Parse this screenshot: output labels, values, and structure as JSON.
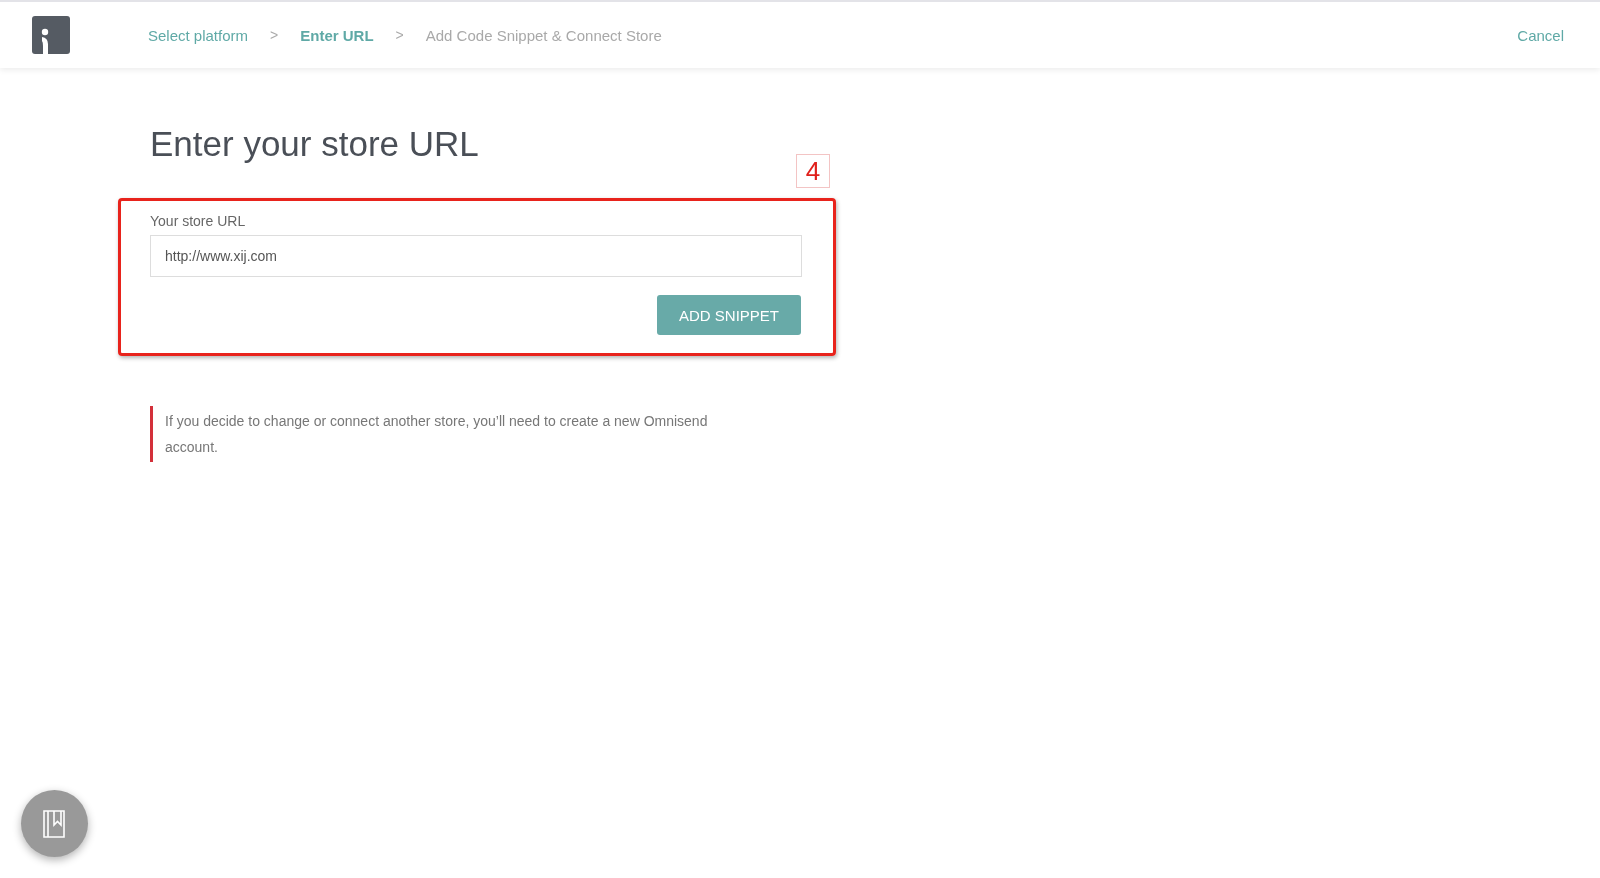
{
  "header": {
    "steps": [
      {
        "label": "Select platform",
        "selected": false,
        "disabled": false
      },
      {
        "label": "Enter URL",
        "selected": true,
        "disabled": false
      },
      {
        "label": "Add Code Snippet & Connect Store",
        "selected": false,
        "disabled": true
      }
    ],
    "separators": [
      ">",
      ">"
    ],
    "cancel": "Cancel"
  },
  "title": "Enter your store URL",
  "annotation": {
    "number": "4"
  },
  "form": {
    "label": "Your store URL",
    "value": "http://www.xij.com",
    "button": "ADD SNIPPET"
  },
  "note": "If you decide to change or connect another store, you’ll need to create a new Omnisend account."
}
